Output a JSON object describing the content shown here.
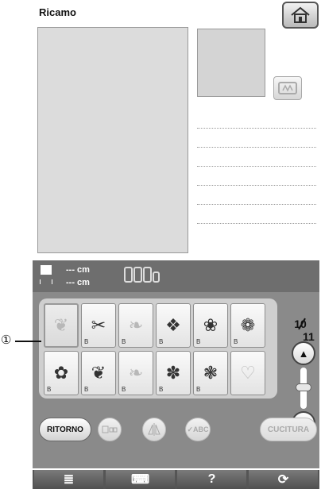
{
  "title": "Ricamo",
  "size_bar": {
    "width_text": "--- cm",
    "height_text": "--- cm"
  },
  "patterns": [
    {
      "sub": "",
      "glyph": "❦",
      "selected": true,
      "faint": true
    },
    {
      "sub": "B",
      "glyph": "✂",
      "faint": false
    },
    {
      "sub": "B",
      "glyph": "❧",
      "faint": true
    },
    {
      "sub": "B",
      "glyph": "❖",
      "faint": false
    },
    {
      "sub": "B",
      "glyph": "❀",
      "faint": false
    },
    {
      "sub": "B",
      "glyph": "❁",
      "faint": false
    },
    {
      "sub": "B",
      "glyph": "✿",
      "faint": false
    },
    {
      "sub": "B",
      "glyph": "❦",
      "faint": false
    },
    {
      "sub": "B",
      "glyph": "❧",
      "faint": true
    },
    {
      "sub": "B",
      "glyph": "✽",
      "faint": false
    },
    {
      "sub": "B",
      "glyph": "❃",
      "faint": false
    },
    {
      "sub": "",
      "glyph": "♡",
      "faint": true
    }
  ],
  "page": {
    "current": "10",
    "total": "11"
  },
  "buttons": {
    "back": "RITORNO",
    "abc": "✓ABC",
    "sew": "CUCITURA"
  },
  "tabs": [
    "≣",
    "⌨",
    "?",
    "⟳"
  ],
  "callout": "①"
}
